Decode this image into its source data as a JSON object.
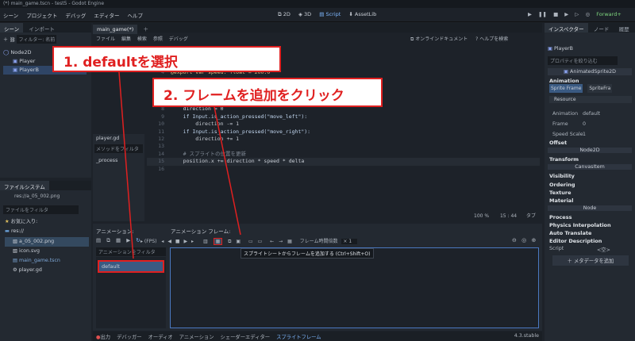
{
  "title": "(*) main_game.tscn - test5 - Godot Engine",
  "menu": [
    "シーン",
    "プロジェクト",
    "デバッグ",
    "エディター",
    "ヘルプ"
  ],
  "workspace": [
    "2D",
    "3D",
    "Script",
    "AssetLib"
  ],
  "renderer": "Forward+",
  "scene_dock": {
    "tabs": [
      "シーン",
      "インポート"
    ],
    "filter": "フィルター: 名前",
    "nodes": [
      "Node2D",
      "Player",
      "PlayerB"
    ]
  },
  "filesystem": {
    "title": "ファイルシステム",
    "path": "res://a_05_002.png",
    "filter": "ファイルをフィルタ",
    "favorites": "お気に入り:",
    "items": [
      "res://",
      "a_05_002.png",
      "icon.svg",
      "main_game.tscn",
      "player.gd"
    ]
  },
  "script_tabs": {
    "tab": "main_game(*)",
    "menus": [
      "ファイル",
      "編集",
      "検索",
      "参照",
      "デバッグ"
    ],
    "online_docs": "オンラインドキュメント",
    "help_search": "ヘルプを検索"
  },
  "script_list": {
    "file": "player.gd",
    "methods_filter": "メソッドをフィルタ",
    "method": "_process"
  },
  "code": [
    {
      "n": "4",
      "t": "@export var speed: float = 200.0"
    },
    {
      "n": "8",
      "t": "    direction = 0"
    },
    {
      "n": "9",
      "t": "    if Input.is_action_pressed(\"move_left\"):"
    },
    {
      "n": "10",
      "t": "        direction -= 1"
    },
    {
      "n": "11",
      "t": "    if Input.is_action_pressed(\"move_right\"):"
    },
    {
      "n": "12",
      "t": "        direction += 1"
    },
    {
      "n": "13",
      "t": ""
    },
    {
      "n": "14",
      "t": "    # スプライトの位置を更新"
    },
    {
      "n": "15",
      "t": "    position.x += direction * speed * delta"
    },
    {
      "n": "16",
      "t": ""
    }
  ],
  "status": {
    "zoom": "100 %",
    "pos": "15 :  44",
    "tab": "タブ"
  },
  "anim": {
    "left_title": "アニメーション:",
    "right_title": "アニメーション フレーム:",
    "fps": "(FPS)",
    "frame_time": "フレーム時間倍数",
    "frame_time_val": "× 1",
    "filter": "アニメーションをフィルタ",
    "item": "default",
    "tooltip": "スプライトシートからフレームを追加する (Ctrl+Shift+O)"
  },
  "bottom_tabs": [
    "出力",
    "デバッガー",
    "オーディオ",
    "アニメーション",
    "シェーダーエディター",
    "スプライトフレーム"
  ],
  "version": "4.3.stable",
  "inspector": {
    "tabs": [
      "インスペクター",
      "ノード",
      "履歴"
    ],
    "node": "PlayerB",
    "filter": "プロパティを絞り込む",
    "class": "AnimatedSprite2D",
    "sections": {
      "animation": "Animation",
      "sprite_frames": "Sprite Frame",
      "sprite_frames_val": "SpriteFra",
      "resource": "Resource",
      "anim_label": "Animation",
      "anim_val": "default",
      "frame": "Frame",
      "frame_val": "0",
      "speed": "Speed Scale",
      "speed_val": "1",
      "offset": "Offset",
      "node2d": "Node2D",
      "transform": "Transform",
      "canvas": "CanvasItem",
      "visibility": "Visibility",
      "ordering": "Ordering",
      "texture": "Texture",
      "material": "Material",
      "node": "Node",
      "process": "Process",
      "physics": "Physics Interpolation",
      "auto": "Auto Translate",
      "editor": "Editor Description",
      "script": "Script",
      "script_val": "<空>",
      "add_meta": "メタデータを追加"
    }
  },
  "callouts": {
    "one": "1. defaultを選択",
    "two": "2. フレームを追加をクリック"
  },
  "colors": {
    "accent": "#478cbf",
    "callout_red": "#e02020"
  }
}
